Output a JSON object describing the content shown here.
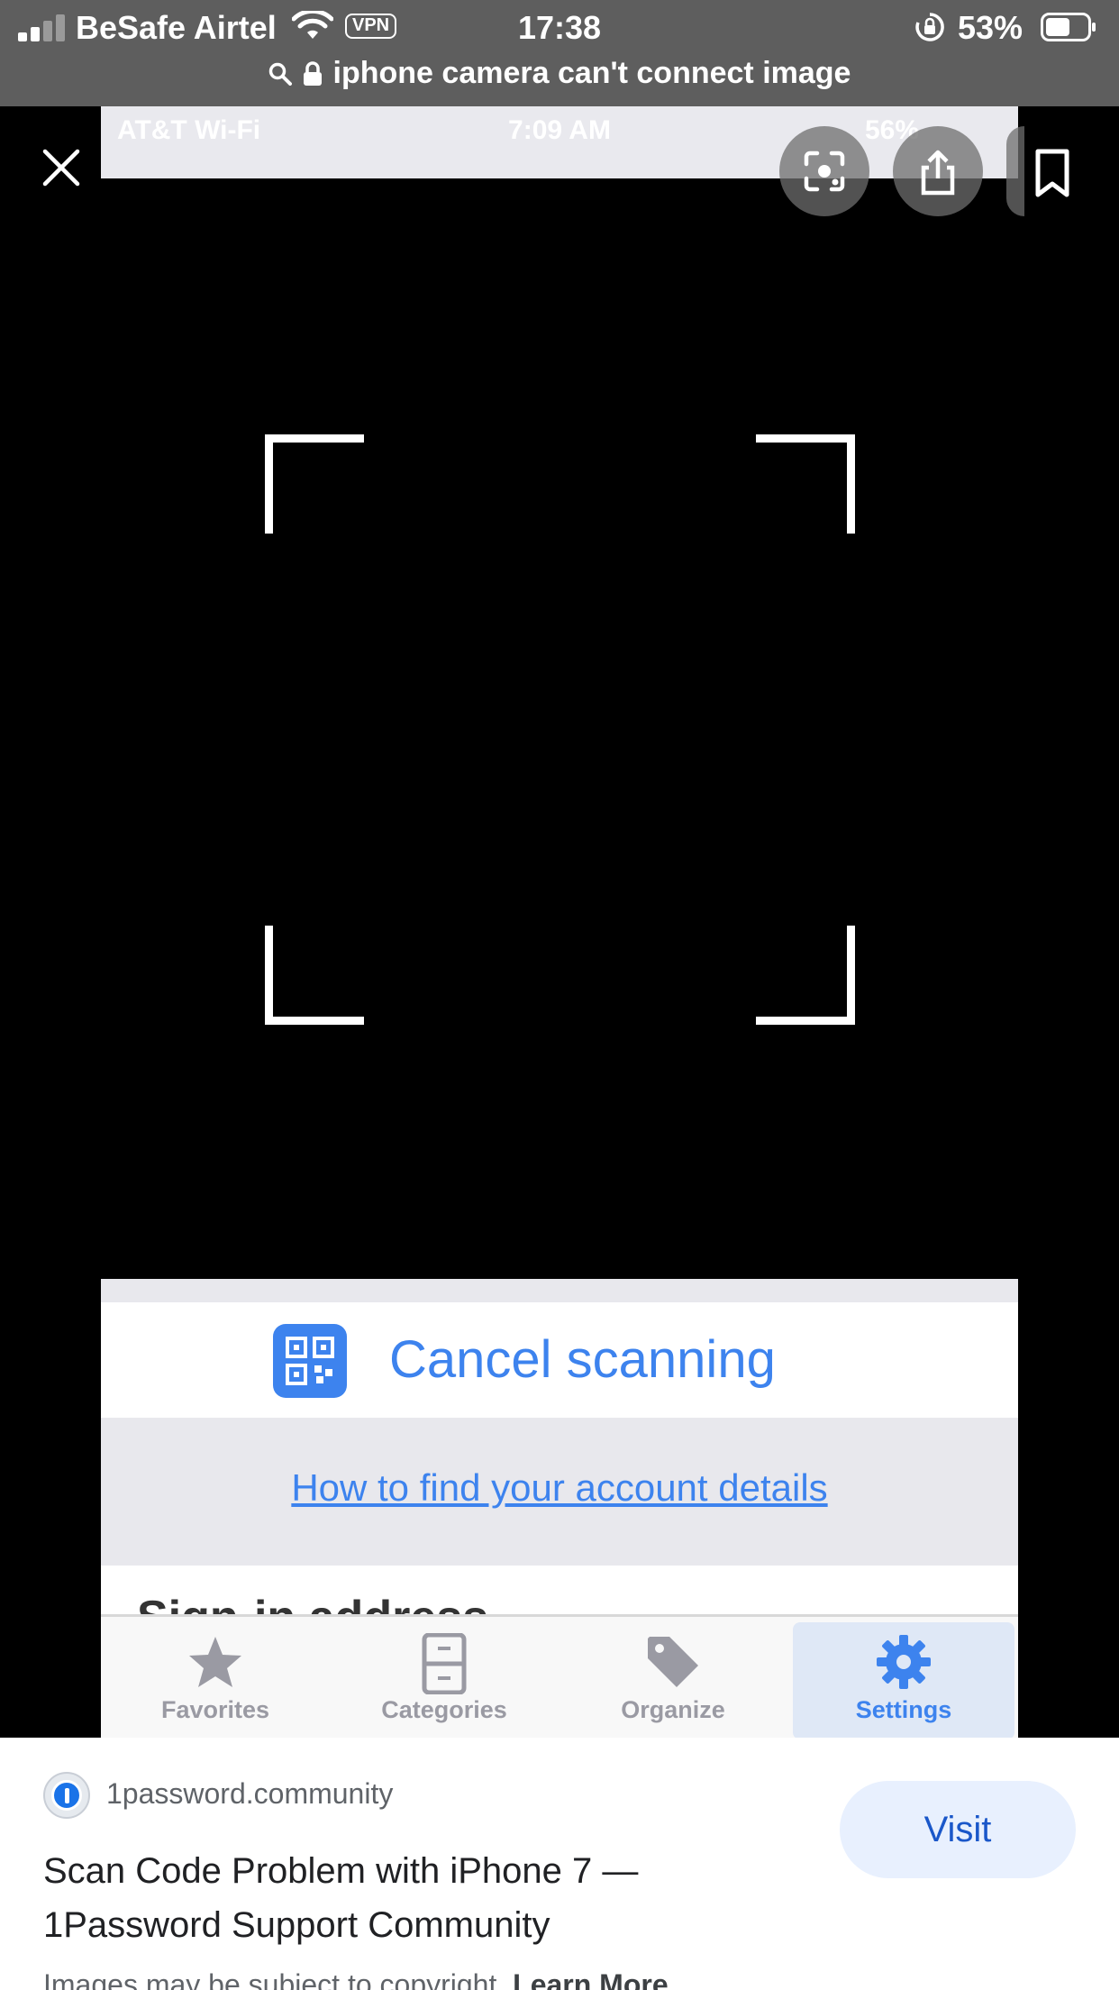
{
  "status_bar": {
    "carrier": "BeSafe Airtel",
    "vpn": "VPN",
    "time": "17:38",
    "battery": "53%"
  },
  "url_bar": {
    "query": "iphone camera can't connect image"
  },
  "viewer": {
    "screenshot_status": {
      "carrier": "AT&T Wi-Fi",
      "time": "7:09 AM",
      "battery": "56%"
    },
    "cancel_label": "Cancel scanning",
    "help_link": "How to find your account details",
    "signin_label": "Sign-in address",
    "tabs": [
      {
        "label": "Favorites",
        "icon": "star-icon"
      },
      {
        "label": "Categories",
        "icon": "cabinet-icon"
      },
      {
        "label": "Organize",
        "icon": "tag-icon"
      },
      {
        "label": "Settings",
        "icon": "gear-icon",
        "selected": true
      }
    ]
  },
  "sheet": {
    "site": "1password.community",
    "title": "Scan Code Problem with iPhone 7 — 1Password Support Community",
    "visit_label": "Visit",
    "copyright_text": "Images may be subject to copyright.",
    "learn_more": "Learn More"
  },
  "colors": {
    "accent_blue": "#3d83ee",
    "visit_bg": "#e8f0fe",
    "status_bar_bg": "#5e5e5e"
  }
}
